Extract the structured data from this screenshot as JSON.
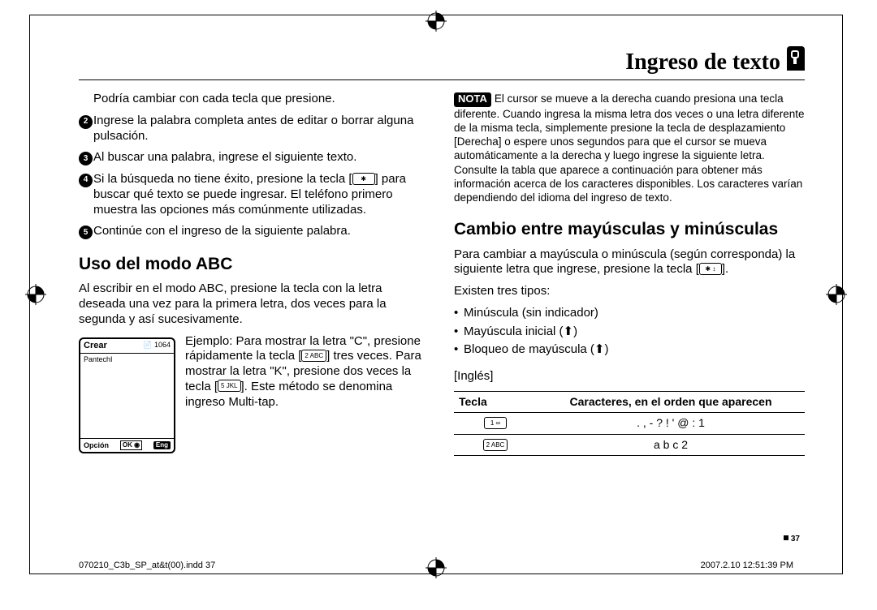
{
  "header": {
    "title": "Ingreso de texto"
  },
  "left": {
    "intro": "Podría cambiar con cada tecla que presione.",
    "steps": [
      {
        "n": "2",
        "text_a": "Ingrese la palabra completa antes de editar o borrar alguna pulsación."
      },
      {
        "n": "3",
        "text_a": "Al buscar una palabra, ingrese el siguiente texto."
      },
      {
        "n": "4",
        "text_a": "Si la búsqueda no tiene éxito, presione la tecla ",
        "key": "✱",
        "text_b": " para buscar qué texto se puede ingresar. El teléfono primero muestra las opciones más comúnmente utilizadas."
      },
      {
        "n": "5",
        "text_a": "Continúe con el ingreso de la siguiente palabra."
      }
    ],
    "section_h": "Uso del modo ABC",
    "lead": "Al escribir en el modo ABC, presione la tecla con la letra deseada una vez para la primera letra, dos veces para la segunda y así sucesivamente.",
    "example_a": "Ejemplo: Para mostrar la letra \"C\", presione rápidamente la tecla ",
    "example_key1": "2 ABC",
    "example_b": " tres veces. Para mostrar la letra \"K\", presione dos veces la tecla ",
    "example_key2": "5 JKL",
    "example_c": ". Este método se denomina ingreso Multi-tap.",
    "phone": {
      "title": "Crear",
      "count": "1064",
      "body": "PantechI",
      "left": "Opción",
      "mid": "OK ◉",
      "right": "Eng"
    }
  },
  "right": {
    "nota_label": "NOTA",
    "nota_text": "El cursor se mueve a la derecha cuando presiona una tecla diferente. Cuando ingresa la misma letra dos veces o una letra diferente de la misma tecla, simplemente presione la tecla de desplazamiento [Derecha] o espere unos segundos para que el cursor se mueva automáticamente a la derecha y luego ingrese la siguiente letra. Consulte la tabla que aparece a continuación para obtener más información acerca de los caracteres disponibles. Los caracteres varían dependiendo del idioma del ingreso de texto.",
    "section_h": "Cambio entre mayúsculas y minúsculas",
    "lead_a": "Para cambiar a mayúscula o minúscula (según corresponda) la siguiente letra que ingrese, presione la tecla ",
    "lead_key": "✱ ↕",
    "lead_b": ".",
    "exist": "Existen tres tipos:",
    "bullets": [
      "Minúscula (sin indicador)",
      "Mayúscula inicial (⬆)",
      "Bloqueo de mayúscula (⬆)"
    ],
    "lang_label": "[Inglés]",
    "table": {
      "h1": "Tecla",
      "h2": "Caracteres, en el orden que aparecen",
      "rows": [
        {
          "key": "1 ∞",
          "chars": ".  ,  -  ?  !  '  @  :  1"
        },
        {
          "key": "2 ABC",
          "chars": "a   b   c   2"
        }
      ]
    }
  },
  "page_number": "37",
  "footer": {
    "left": "070210_C3b_SP_at&t(00).indd   37",
    "right": "2007.2.10   12:51:39 PM"
  }
}
